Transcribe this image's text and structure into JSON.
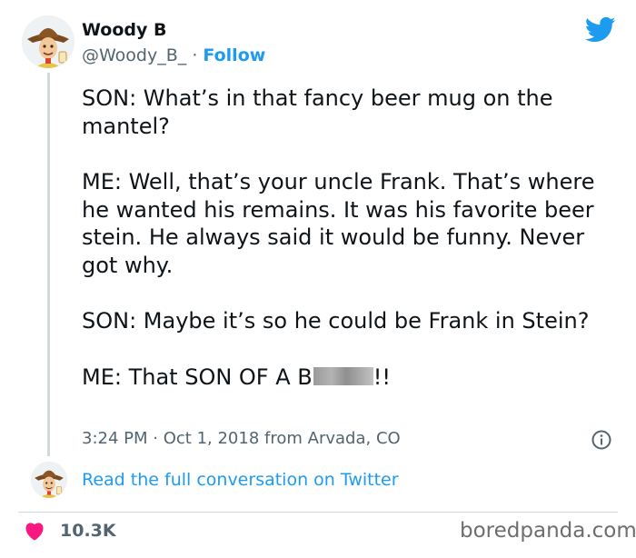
{
  "author": {
    "name": "Woody B",
    "handle": "@Woody_B_",
    "separator": "·",
    "follow_label": "Follow"
  },
  "tweet": {
    "paragraphs": [
      "SON: What’s in that fancy beer mug on the mantel?",
      "ME: Well, that’s your uncle Frank. That’s where he wanted his remains. It was his favorite beer stein. He always said it would be funny. Never got why.",
      "SON: Maybe it’s so he could be Frank in Stein?"
    ],
    "last_line_prefix": "ME: That SON OF A B",
    "last_line_suffix": "!!"
  },
  "meta": {
    "time": "3:24 PM",
    "separator": "·",
    "date": "Oct 1, 2018",
    "location": "from Arvada, CO"
  },
  "read_full_label": "Read the full conversation on Twitter",
  "likes": "10.3K",
  "watermark": "boredpanda.com",
  "icons": {
    "brand": "twitter-bird-icon",
    "info": "info-icon",
    "like": "heart-icon"
  },
  "colors": {
    "link": "#1d9bf0",
    "text": "#0f1419",
    "muted": "#536471",
    "heart": "#f91880",
    "divider": "#cfd9de"
  }
}
